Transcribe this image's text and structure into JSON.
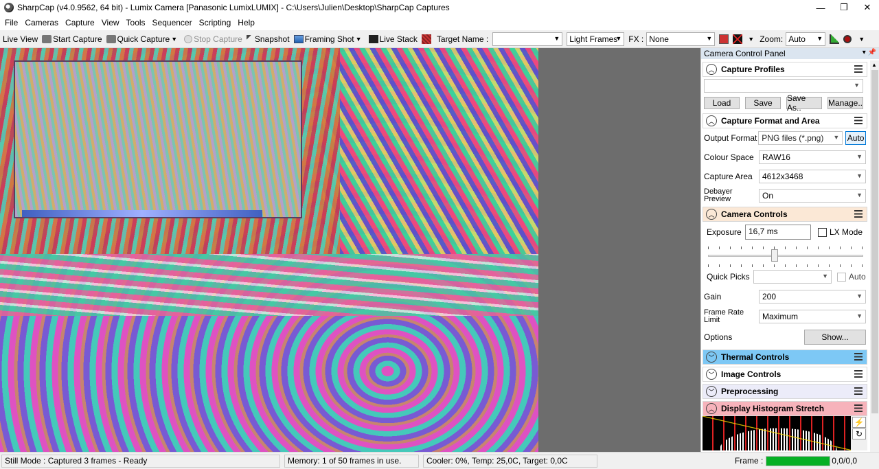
{
  "window": {
    "title": "SharpCap (v4.0.9562, 64 bit) - Lumix Camera [Panasonic LumixLUMIX] - C:\\Users\\Julien\\Desktop\\SharpCap Captures",
    "minimize": "—",
    "maximize": "❐",
    "close": "✕"
  },
  "menu": {
    "items": [
      "File",
      "Cameras",
      "Capture",
      "View",
      "Tools",
      "Sequencer",
      "Scripting",
      "Help"
    ]
  },
  "toolbar": {
    "live_view": "Live View",
    "start_capture": "Start Capture",
    "quick_capture": "Quick Capture",
    "stop_capture": "Stop Capture",
    "snapshot": "Snapshot",
    "framing_shot": "Framing Shot",
    "live_stack": "Live Stack",
    "target_name_label": "Target Name :",
    "target_name_value": "",
    "frame_type": "Light Frames",
    "fx_label": "FX :",
    "fx_value": "None",
    "zoom_label": "Zoom:",
    "zoom_value": "Auto"
  },
  "panel": {
    "title": "Camera Control Panel",
    "capture_profiles": {
      "title": "Capture Profiles",
      "profile_value": "",
      "load": "Load",
      "save": "Save",
      "save_as": "Save As..",
      "manage": "Manage.."
    },
    "capture_format": {
      "title": "Capture Format and Area",
      "output_format_label": "Output Format",
      "output_format_value": "PNG files (*.png)",
      "auto": "Auto",
      "colour_space_label": "Colour Space",
      "colour_space_value": "RAW16",
      "capture_area_label": "Capture Area",
      "capture_area_value": "4612x3468",
      "debayer_label_1": "Debayer",
      "debayer_label_2": "Preview",
      "debayer_value": "On"
    },
    "camera_controls": {
      "title": "Camera Controls",
      "exposure_label": "Exposure",
      "exposure_value": "16,7 ms",
      "lx_mode": "LX Mode",
      "quick_picks_label": "Quick Picks",
      "quick_picks_value": "",
      "auto": "Auto",
      "gain_label": "Gain",
      "gain_value": "200",
      "frame_rate_label_1": "Frame Rate",
      "frame_rate_label_2": "Limit",
      "frame_rate_value": "Maximum",
      "options_label": "Options",
      "show": "Show..."
    },
    "thermal_controls": {
      "title": "Thermal Controls",
      "color": "#7dc8f5"
    },
    "image_controls": {
      "title": "Image Controls"
    },
    "preprocessing": {
      "title": "Preprocessing"
    },
    "histogram": {
      "title": "Display Histogram Stretch",
      "color": "#f7b3bb"
    }
  },
  "status": {
    "mode": "Still Mode : Captured 3 frames - Ready",
    "memory": "Memory: 1 of 50 frames in use.",
    "cooler": "Cooler: 0%, Temp: 25,0C, Target: 0,0C",
    "frame_label": "Frame :",
    "frame_value": "0,0/0,0",
    "frame_progress": 1.0
  }
}
